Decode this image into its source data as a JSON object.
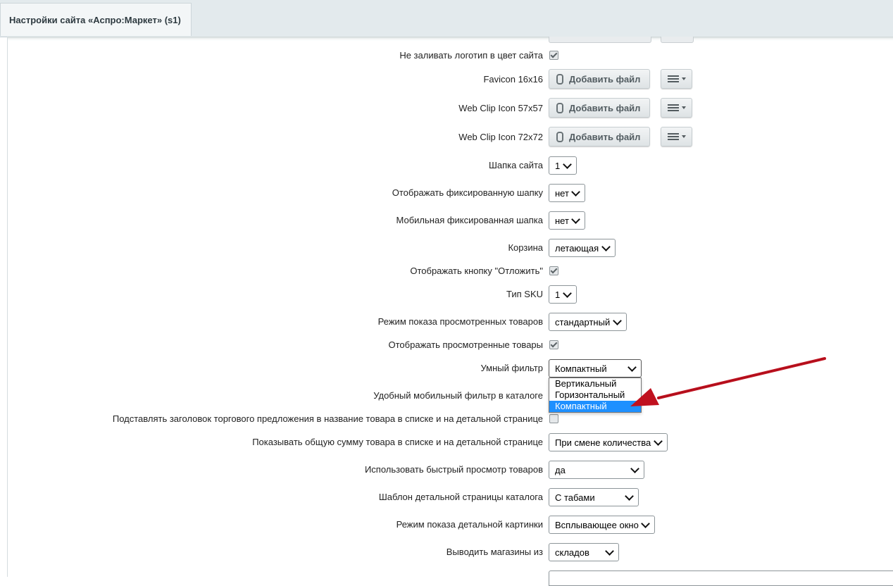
{
  "tab": {
    "title": "Настройки сайта «Аспро:Маркет» (s1)"
  },
  "file_button_label": "Добавить файл",
  "rows": [
    {
      "label": "Не заливать логотип в цвет сайта",
      "checked": true
    },
    {
      "label": "Favicon 16x16"
    },
    {
      "label": "Web Clip Icon 57x57"
    },
    {
      "label": "Web Clip Icon 72x72"
    },
    {
      "label": "Шапка сайта",
      "value": "1"
    },
    {
      "label": "Отображать фиксированную шапку",
      "value": "нет"
    },
    {
      "label": "Мобильная фиксированная шапка",
      "value": "нет"
    },
    {
      "label": "Корзина",
      "value": "летающая"
    },
    {
      "label": "Отображать кнопку \"Отложить\"",
      "checked": true
    },
    {
      "label": "Тип SKU",
      "value": "1"
    },
    {
      "label": "Режим показа просмотренных товаров",
      "value": "стандартный"
    },
    {
      "label": "Отображать просмотренные товары",
      "checked": true
    },
    {
      "label": "Умный фильтр",
      "value": "Компактный"
    },
    {
      "label": "Удобный мобильный фильтр в каталоге"
    },
    {
      "label": "Подставлять заголовок торгового предложения в название товара в списке и на детальной странице",
      "checked": false
    },
    {
      "label": "Показывать общую сумму товара в списке и на детальной странице",
      "value": "При смене количества"
    },
    {
      "label": "Использовать быстрый просмотр товаров",
      "value": "да"
    },
    {
      "label": "Шаблон детальной страницы каталога",
      "value": "С табами"
    },
    {
      "label": "Режим показа детальной картинки",
      "value": "Всплывающее окно"
    },
    {
      "label": "Выводить магазины из",
      "value": "складов"
    }
  ],
  "dropdown": {
    "options": [
      "Вертикальный",
      "Горизонтальный",
      "Компактный"
    ],
    "selected": "Компактный"
  },
  "colors": {
    "highlight": "#1e90ff",
    "arrow": "#c0111f",
    "tab_bg": "#e3eaed"
  }
}
